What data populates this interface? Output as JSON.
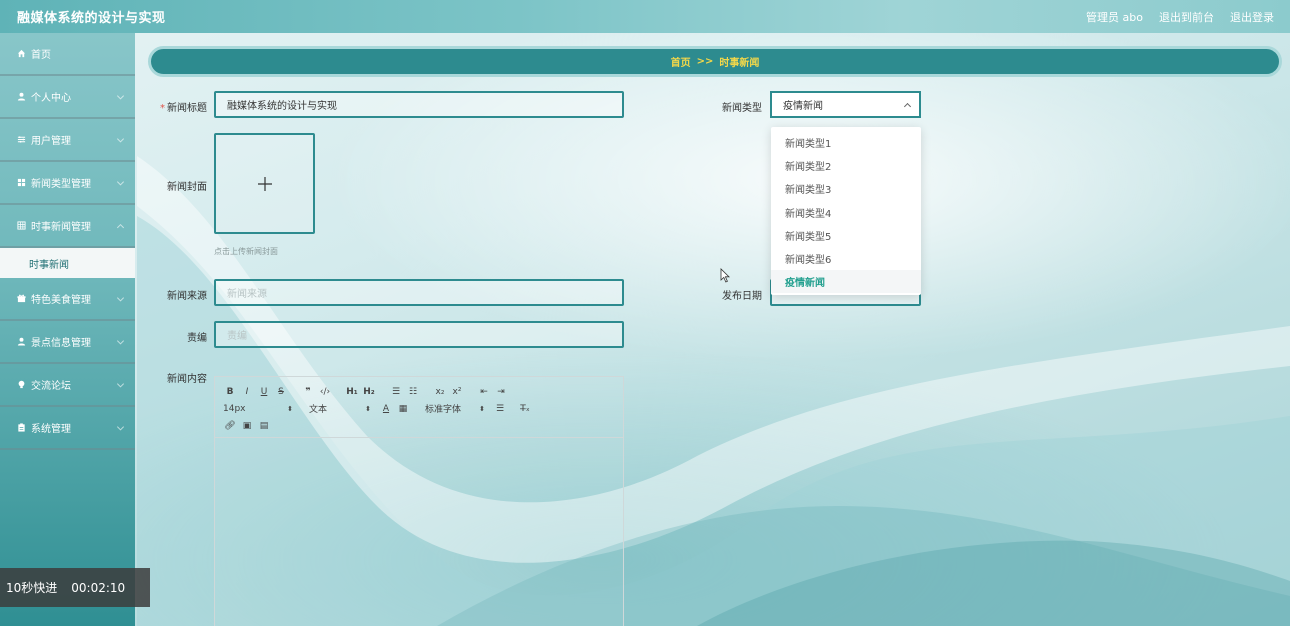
{
  "header": {
    "title": "融媒体系统的设计与实现",
    "user_label": "管理员 abo",
    "front_link": "退出到前台",
    "logout": "退出登录"
  },
  "sidebar": {
    "items": [
      {
        "label": "首页",
        "icon": "home-icon"
      },
      {
        "label": "个人中心",
        "icon": "user-icon"
      },
      {
        "label": "用户管理",
        "icon": "sliders-icon"
      },
      {
        "label": "新闻类型管理",
        "icon": "grid-icon"
      },
      {
        "label": "时事新闻管理",
        "icon": "table-icon"
      },
      {
        "label": "特色美食管理",
        "icon": "gift-icon"
      },
      {
        "label": "景点信息管理",
        "icon": "user-icon"
      },
      {
        "label": "交流论坛",
        "icon": "bulb-icon"
      },
      {
        "label": "系统管理",
        "icon": "clipboard-icon"
      }
    ],
    "active_sub": "时事新闻"
  },
  "breadcrumb": {
    "home": "首页",
    "sep": ">>",
    "current": "时事新闻"
  },
  "form": {
    "title_label": "新闻标题",
    "title_value": "融媒体系统的设计与实现",
    "cover_label": "新闻封面",
    "cover_tip": "点击上传新闻封面",
    "source_label": "新闻来源",
    "source_placeholder": "新闻来源",
    "editor_label": "责编",
    "editor_placeholder": "责编",
    "content_label": "新闻内容",
    "type_label": "新闻类型",
    "type_value": "疫情新闻",
    "date_label": "发布日期"
  },
  "dropdown": {
    "options": [
      "新闻类型1",
      "新闻类型2",
      "新闻类型3",
      "新闻类型4",
      "新闻类型5",
      "新闻类型6",
      "疫情新闻"
    ],
    "selected": "疫情新闻"
  },
  "editor_toolbar": {
    "font_size": "14px",
    "text_style": "文本",
    "font_family": "标准字体"
  },
  "video": {
    "skip": "10秒快进",
    "time": "00:02:10"
  },
  "colors": {
    "accent": "#2d8b8f",
    "breadcrumb_text": "#f3d84a",
    "selected_option": "#23a08f"
  }
}
